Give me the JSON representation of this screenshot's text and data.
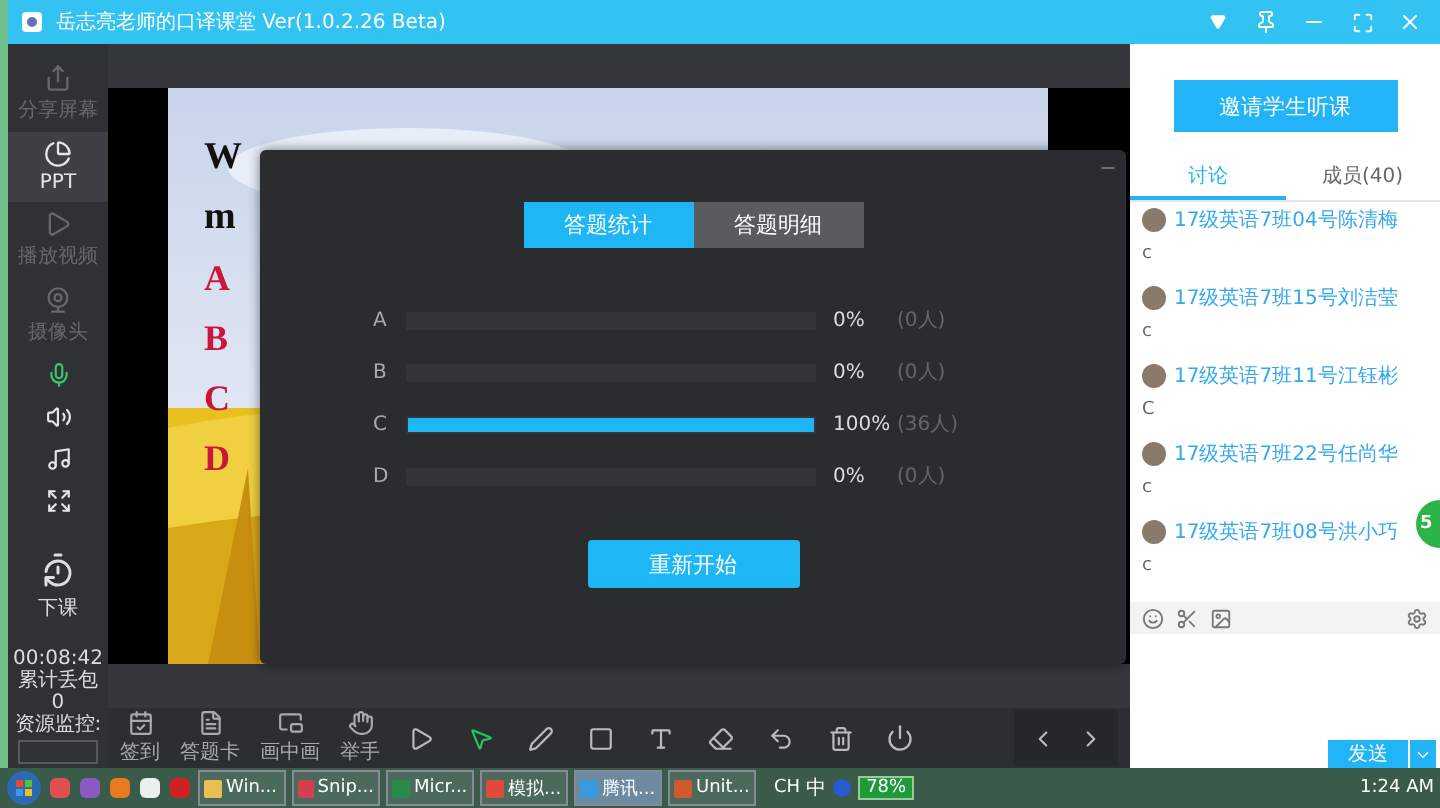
{
  "window": {
    "title": "岳志亮老师的口译课堂 Ver(1.0.2.26 Beta)"
  },
  "sidebar": {
    "items": [
      {
        "kind": "share",
        "label": "分享屏幕",
        "disabled": true,
        "selected": false
      },
      {
        "kind": "ppt",
        "label": "PPT",
        "disabled": false,
        "selected": true
      },
      {
        "kind": "video",
        "label": "播放视频",
        "disabled": true,
        "selected": false
      },
      {
        "kind": "camera",
        "label": "摄像头",
        "disabled": true,
        "selected": false
      },
      {
        "kind": "mic",
        "disabled": false,
        "selected": false
      },
      {
        "kind": "speaker",
        "disabled": false,
        "selected": false
      },
      {
        "kind": "music",
        "disabled": false,
        "selected": false
      },
      {
        "kind": "fullscreen",
        "disabled": false,
        "selected": false
      }
    ],
    "end_button": "下课",
    "timer": "00:08:42",
    "packet_loss_label": "累计丢包",
    "packet_loss_value": "0",
    "monitor_label": "资源监控:"
  },
  "slide": {
    "lines": [
      {
        "kind": "heading",
        "text": "W"
      },
      {
        "kind": "heading",
        "text": "m"
      },
      {
        "kind": "option",
        "text": "A"
      },
      {
        "kind": "option",
        "text": "B"
      },
      {
        "kind": "option",
        "text": "C"
      },
      {
        "kind": "option",
        "text": "D"
      }
    ]
  },
  "dialog": {
    "tabs": [
      {
        "label": "答题统计",
        "selected": true
      },
      {
        "label": "答题明细",
        "selected": false
      }
    ],
    "rows": [
      {
        "letter": "A",
        "level": 0,
        "percent": "0%",
        "count": "(0人)"
      },
      {
        "letter": "B",
        "level": 0,
        "percent": "0%",
        "count": "(0人)"
      },
      {
        "letter": "C",
        "level": 1,
        "percent": "100%",
        "count": "(36人)"
      },
      {
        "letter": "D",
        "level": 0,
        "percent": "0%",
        "count": "(0人)"
      }
    ],
    "restart_button": "重新开始"
  },
  "toolbar": {
    "items": [
      {
        "kind": "checkin",
        "label": "签到"
      },
      {
        "kind": "answer-card",
        "label": "答题卡"
      },
      {
        "kind": "pip",
        "label": "画中画"
      },
      {
        "kind": "hand",
        "label": "举手"
      }
    ],
    "tools": [
      {
        "kind": "play",
        "selected": false
      },
      {
        "kind": "pointer",
        "selected": true
      },
      {
        "kind": "pen",
        "selected": false
      },
      {
        "kind": "shape",
        "selected": false
      },
      {
        "kind": "text",
        "selected": false
      },
      {
        "kind": "eraser",
        "selected": false
      },
      {
        "kind": "undo",
        "selected": false
      },
      {
        "kind": "clear",
        "selected": false
      },
      {
        "kind": "power",
        "selected": false
      }
    ]
  },
  "right_panel": {
    "invite_button": "邀请学生听课",
    "tabs": [
      {
        "label": "讨论",
        "selected": true
      },
      {
        "label": "成员(40)",
        "selected": false
      }
    ],
    "messages": [
      {
        "name": "17级英语7班04号陈清梅",
        "text": "c"
      },
      {
        "name": "17级英语7班15号刘洁莹",
        "text": "c"
      },
      {
        "name": "17级英语7班11号江钰彬",
        "text": "C"
      },
      {
        "name": "17级英语7班22号任尚华",
        "text": "c"
      },
      {
        "name": "17级英语7班08号洪小巧",
        "text": "c"
      }
    ],
    "send_button": "发送"
  },
  "floating_badge": "5",
  "taskbar": {
    "tasks": [
      {
        "kind": "folder",
        "label": "Win...",
        "selected": false
      },
      {
        "kind": "snip",
        "label": "Snip...",
        "selected": false
      },
      {
        "kind": "excel",
        "label": "Micr...",
        "selected": false
      },
      {
        "kind": "chrome",
        "label": "模拟...",
        "selected": false
      },
      {
        "kind": "tencent",
        "label": "腾讯...",
        "selected": true
      },
      {
        "kind": "word",
        "label": "Unit...",
        "selected": false
      }
    ],
    "language": "CH",
    "ime": "中",
    "battery": "78%",
    "time": "1:24 AM"
  }
}
